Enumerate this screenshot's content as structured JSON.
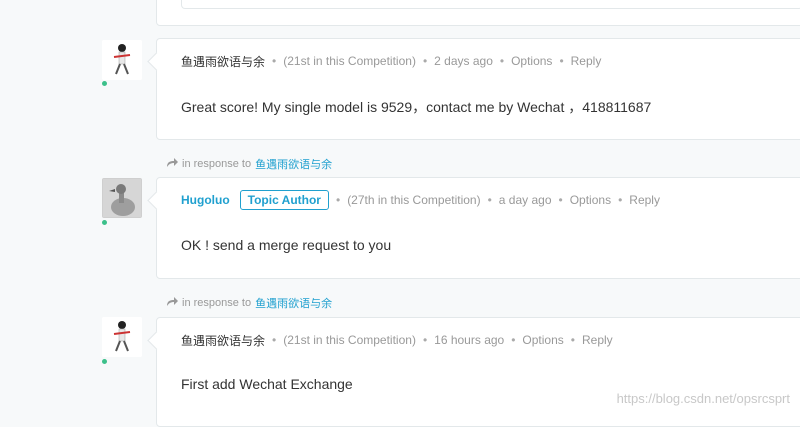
{
  "comments": [
    {
      "author": "鱼遇雨欲语与余",
      "rank": "(21st in this Competition)",
      "time": "2 days ago",
      "options": "Options",
      "reply": "Reply",
      "text": "Great score! My single model is 9529，contact me by Wechat ，418811687"
    },
    {
      "in_response_label": "in response to",
      "in_response_to": "鱼遇雨欲语与余",
      "author": "Hugoluo",
      "badge": "Topic Author",
      "rank": "(27th in this Competition)",
      "time": "a day ago",
      "options": "Options",
      "reply": "Reply",
      "text": "OK ! send a merge request to you"
    },
    {
      "in_response_label": "in response to",
      "in_response_to": "鱼遇雨欲语与余",
      "author": "鱼遇雨欲语与余",
      "rank": "(21st in this Competition)",
      "time": "16 hours ago",
      "options": "Options",
      "reply": "Reply",
      "text": "First add Wechat Exchange"
    }
  ],
  "colors": {
    "link": "#20a0cf",
    "online_blue": "#20beff",
    "online_green": "#3cc08a"
  },
  "icons": {
    "reply_arrow": "share-arrow-icon"
  },
  "watermark": "https://blog.csdn.net/opsrcsprt"
}
